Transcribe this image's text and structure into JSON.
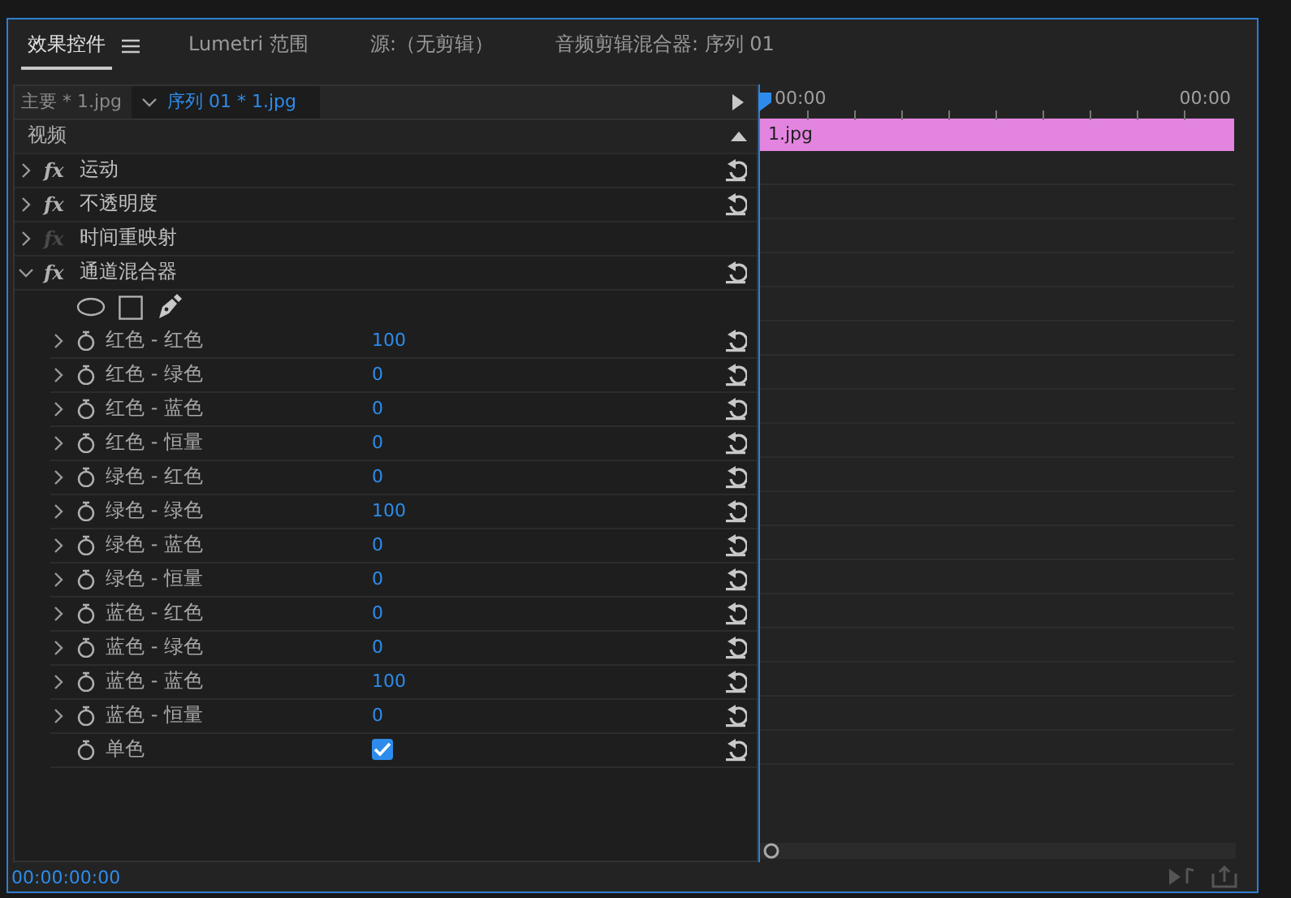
{
  "tabs": [
    {
      "label": "效果控件",
      "selected": true
    },
    {
      "label": "Lumetri 范围",
      "selected": false
    },
    {
      "label": "源:（无剪辑）",
      "selected": false
    },
    {
      "label": "音频剪辑混合器: 序列 01",
      "selected": false
    }
  ],
  "source": {
    "master": "主要 * 1.jpg",
    "sequence": "序列 01 * 1.jpg"
  },
  "section": "视频",
  "effects": [
    {
      "name": "运动",
      "badge": "fx",
      "expanded": false,
      "enabled": true
    },
    {
      "name": "不透明度",
      "badge": "fx",
      "expanded": false,
      "enabled": true
    },
    {
      "name": "时间重映射",
      "badge": "fx",
      "expanded": false,
      "enabled": false
    },
    {
      "name": "通道混合器",
      "badge": "fx",
      "expanded": true,
      "enabled": true,
      "params": [
        {
          "kind": "number",
          "name": "红色 - 红色",
          "value": "100"
        },
        {
          "kind": "number",
          "name": "红色 - 绿色",
          "value": "0"
        },
        {
          "kind": "number",
          "name": "红色 - 蓝色",
          "value": "0"
        },
        {
          "kind": "number",
          "name": "红色 - 恒量",
          "value": "0"
        },
        {
          "kind": "number",
          "name": "绿色 - 红色",
          "value": "0"
        },
        {
          "kind": "number",
          "name": "绿色 - 绿色",
          "value": "100"
        },
        {
          "kind": "number",
          "name": "绿色 - 蓝色",
          "value": "0"
        },
        {
          "kind": "number",
          "name": "绿色 - 恒量",
          "value": "0"
        },
        {
          "kind": "number",
          "name": "蓝色 - 红色",
          "value": "0"
        },
        {
          "kind": "number",
          "name": "蓝色 - 绿色",
          "value": "0"
        },
        {
          "kind": "number",
          "name": "蓝色 - 蓝色",
          "value": "100"
        },
        {
          "kind": "number",
          "name": "蓝色 - 恒量",
          "value": "0"
        },
        {
          "kind": "checkbox",
          "name": "单色",
          "checked": true
        }
      ]
    }
  ],
  "timeline": {
    "start": "00:00",
    "end": "00:00",
    "clip": "1.jpg"
  },
  "timecode": "00:00:00:00"
}
